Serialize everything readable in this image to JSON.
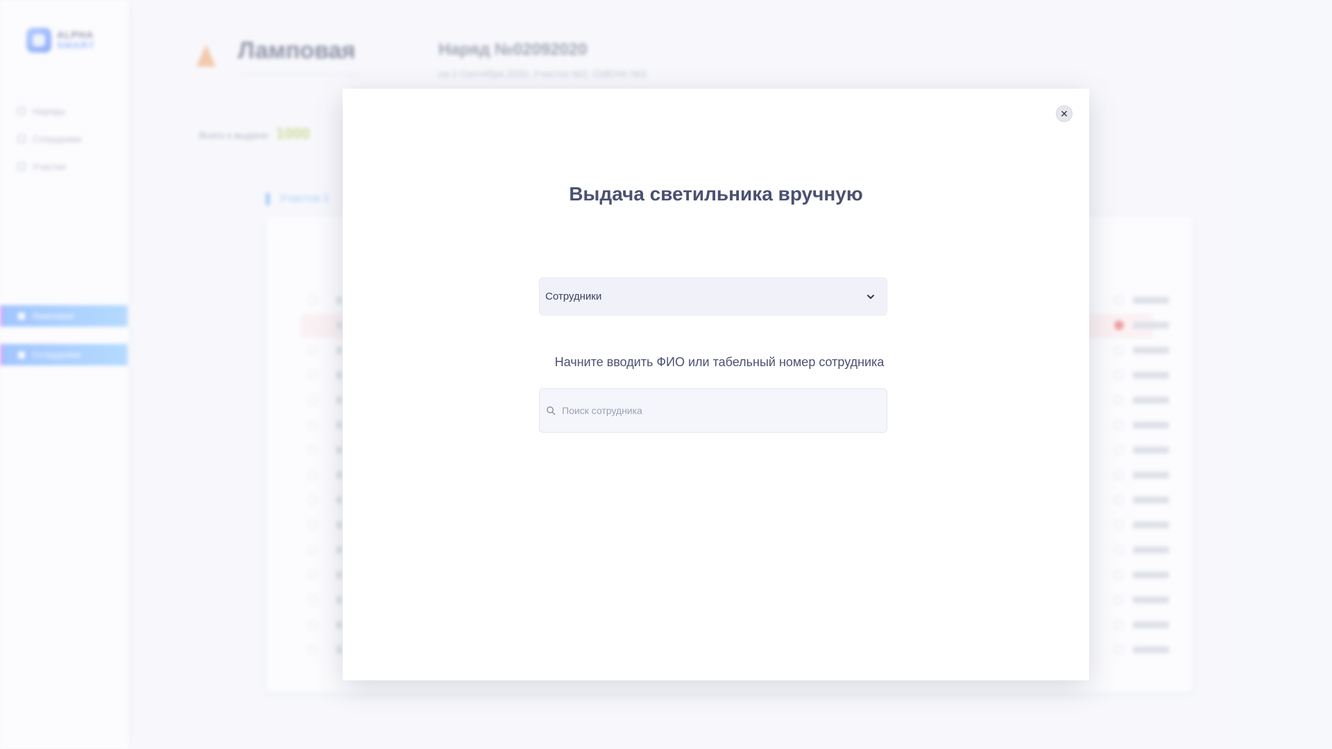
{
  "background": {
    "logo": {
      "line1": "ALPHA",
      "line2": "SMART"
    },
    "nav": [
      {
        "label": "Наряды"
      },
      {
        "label": "Сотрудники"
      },
      {
        "label": "Участки"
      }
    ],
    "side_buttons": [
      {
        "label": "Ламповая"
      },
      {
        "label": "Сотрудники"
      }
    ],
    "header": {
      "title": "Ламповая",
      "order_title": "Наряд №02092020",
      "order_subtitle": "на 2 Сентября 2020, Участок №2, СМЕНА №3"
    },
    "stats": {
      "label": "Всего к выдаче:",
      "value": "1000"
    },
    "section": {
      "label": "Участок 1"
    }
  },
  "modal": {
    "title": "Выдача светильника вручную",
    "select": {
      "value": "Сотрудники"
    },
    "hint": "Начните вводить ФИО или табельный номер сотрудника",
    "search": {
      "placeholder": "Поиск сотрудника"
    },
    "close_symbol": "✕"
  },
  "colors": {
    "accent": "#5b9cff",
    "title": "#4a5172",
    "stat_value": "#a9c24a",
    "alert": "#e45959"
  }
}
